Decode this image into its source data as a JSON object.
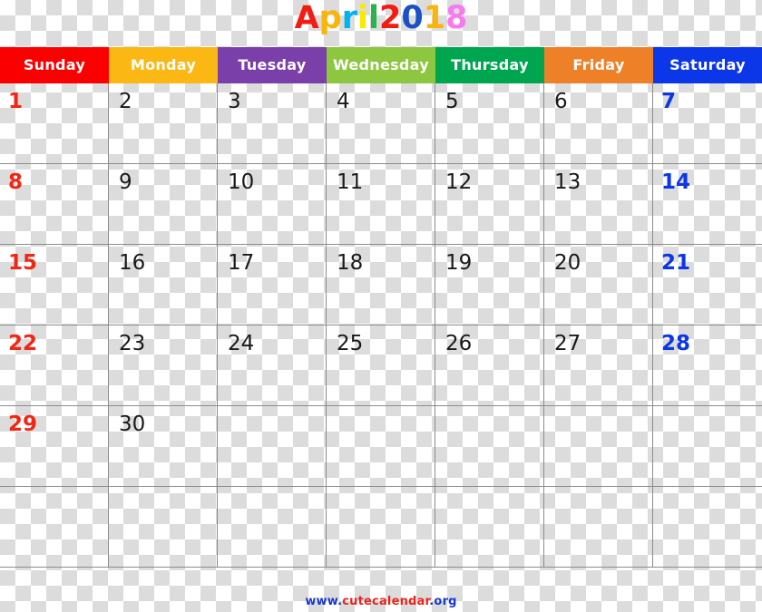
{
  "title": {
    "month": "April",
    "year": "2018",
    "letters": [
      {
        "char": "A",
        "color": "#f11c12"
      },
      {
        "char": "p",
        "color": "#f9b50b"
      },
      {
        "char": "r",
        "color": "#00b2ef"
      },
      {
        "char": "i",
        "color": "#fde900"
      },
      {
        "char": "l",
        "color": "#2bb24c"
      },
      {
        "char": "2",
        "color": "#f11c12"
      },
      {
        "char": "0",
        "color": "#1a52c4"
      },
      {
        "char": "1",
        "color": "#f9b50b"
      },
      {
        "char": "8",
        "color": "#f77bee"
      }
    ]
  },
  "header": {
    "days": [
      {
        "label": "Sunday",
        "color": "#fa0000"
      },
      {
        "label": "Monday",
        "color": "#fbb713"
      },
      {
        "label": "Tuesday",
        "color": "#7a3fa8"
      },
      {
        "label": "Wednesday",
        "color": "#8dc63f"
      },
      {
        "label": "Thursday",
        "color": "#00a550"
      },
      {
        "label": "Friday",
        "color": "#ee8128"
      },
      {
        "label": "Saturday",
        "color": "#0b37e8"
      }
    ]
  },
  "colors": {
    "sunday_date": "#f22613",
    "saturday_date": "#0b37e8",
    "weekday_date": "#1a1a1a",
    "grid_line": "#8c8c8c"
  },
  "weeks": [
    [
      {
        "num": "1",
        "kind": "sun"
      },
      {
        "num": "2",
        "kind": "weekday"
      },
      {
        "num": "3",
        "kind": "weekday"
      },
      {
        "num": "4",
        "kind": "weekday"
      },
      {
        "num": "5",
        "kind": "weekday"
      },
      {
        "num": "6",
        "kind": "weekday"
      },
      {
        "num": "7",
        "kind": "sat"
      }
    ],
    [
      {
        "num": "8",
        "kind": "sun"
      },
      {
        "num": "9",
        "kind": "weekday"
      },
      {
        "num": "10",
        "kind": "weekday"
      },
      {
        "num": "11",
        "kind": "weekday"
      },
      {
        "num": "12",
        "kind": "weekday"
      },
      {
        "num": "13",
        "kind": "weekday"
      },
      {
        "num": "14",
        "kind": "sat"
      }
    ],
    [
      {
        "num": "15",
        "kind": "sun"
      },
      {
        "num": "16",
        "kind": "weekday"
      },
      {
        "num": "17",
        "kind": "weekday"
      },
      {
        "num": "18",
        "kind": "weekday"
      },
      {
        "num": "19",
        "kind": "weekday"
      },
      {
        "num": "20",
        "kind": "weekday"
      },
      {
        "num": "21",
        "kind": "sat"
      }
    ],
    [
      {
        "num": "22",
        "kind": "sun"
      },
      {
        "num": "23",
        "kind": "weekday"
      },
      {
        "num": "24",
        "kind": "weekday"
      },
      {
        "num": "25",
        "kind": "weekday"
      },
      {
        "num": "26",
        "kind": "weekday"
      },
      {
        "num": "27",
        "kind": "weekday"
      },
      {
        "num": "28",
        "kind": "sat"
      }
    ],
    [
      {
        "num": "29",
        "kind": "sun"
      },
      {
        "num": "30",
        "kind": "weekday"
      },
      {
        "num": "",
        "kind": "weekday"
      },
      {
        "num": "",
        "kind": "weekday"
      },
      {
        "num": "",
        "kind": "weekday"
      },
      {
        "num": "",
        "kind": "weekday"
      },
      {
        "num": "",
        "kind": "sat"
      }
    ],
    [
      {
        "num": "",
        "kind": "sun"
      },
      {
        "num": "",
        "kind": "weekday"
      },
      {
        "num": "",
        "kind": "weekday"
      },
      {
        "num": "",
        "kind": "weekday"
      },
      {
        "num": "",
        "kind": "weekday"
      },
      {
        "num": "",
        "kind": "weekday"
      },
      {
        "num": "",
        "kind": "sat"
      }
    ]
  ],
  "footer": {
    "prefix": "www.",
    "name": "cutecalendar",
    "suffix": ".org"
  }
}
